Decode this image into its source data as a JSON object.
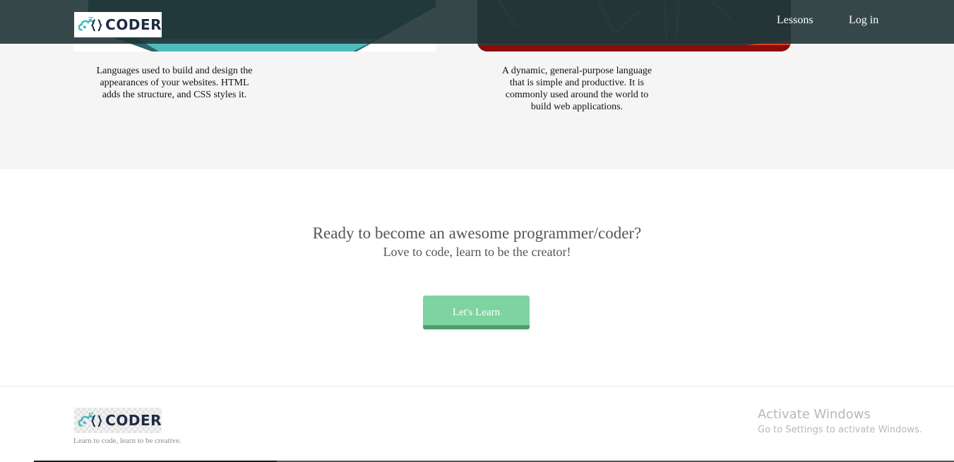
{
  "brand": {
    "logo_text": "CODER",
    "tagline": "Learn to code, learn to be creative."
  },
  "nav": {
    "items": [
      {
        "label": "Lessons"
      },
      {
        "label": "Log in"
      }
    ]
  },
  "courses": [
    {
      "description": "Languages used to build and design the appearances of your websites. HTML adds the structure, and CSS styles it."
    },
    {
      "description": "A dynamic, general-purpose language that is simple and productive. It is commonly used around the world to build web applications."
    }
  ],
  "cta": {
    "title": "Ready to become an awesome programmer/coder?",
    "subtitle": "Love to code, learn to be the creator!",
    "button_label": "Let's Learn"
  },
  "watermark": {
    "title": "Activate Windows",
    "subtitle": "Go to Settings to activate Windows."
  },
  "colors": {
    "navbar": "#213437",
    "band": "#f5f5f5",
    "button": "#7dd4a0",
    "button_shadow": "#4f9e6d",
    "logo_icon": "#3fb7c6",
    "logo_text": "#1f2a44"
  }
}
